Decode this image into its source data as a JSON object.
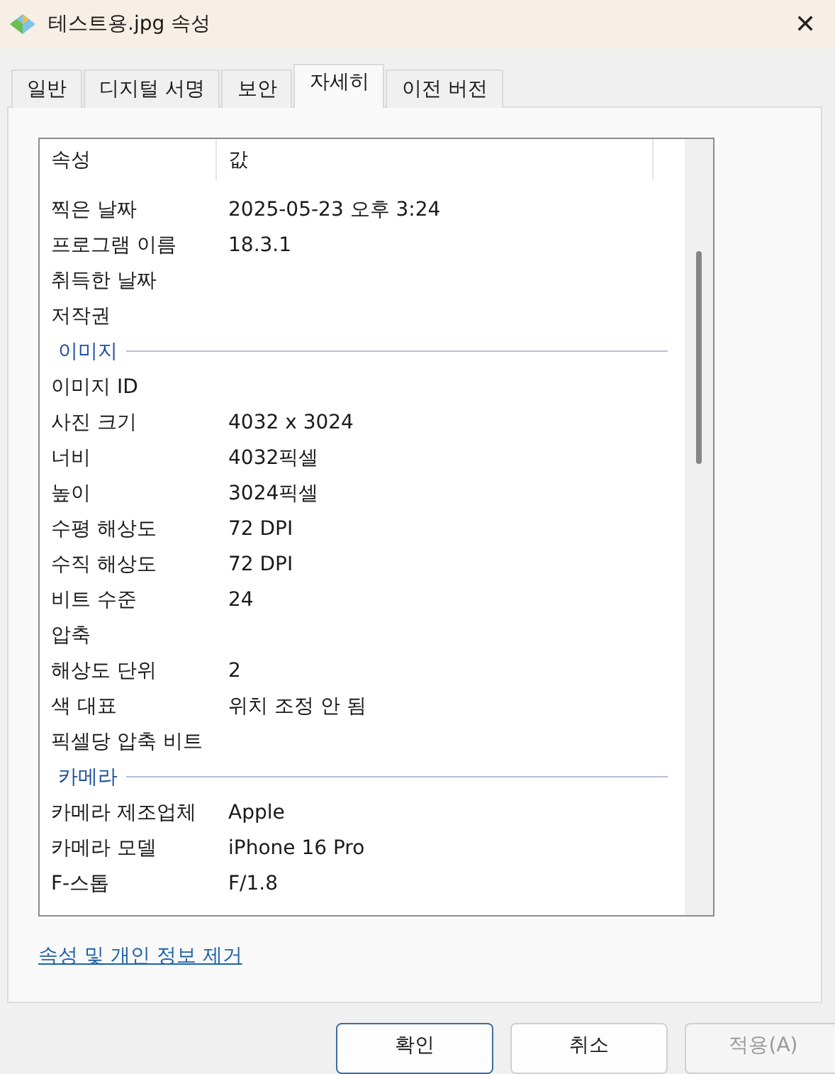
{
  "window": {
    "title": "테스트용.jpg 속성",
    "close": "✕"
  },
  "tabs": [
    {
      "label": "일반",
      "selected": false
    },
    {
      "label": "디지털 서명",
      "selected": false
    },
    {
      "label": "보안",
      "selected": false
    },
    {
      "label": "자세히",
      "selected": true
    },
    {
      "label": "이전 버전",
      "selected": false
    }
  ],
  "table": {
    "columns": [
      "속성",
      "값"
    ],
    "rows": [
      {
        "kind": "row",
        "name": "찍은 날짜",
        "value": "2025-05-23 오후 3:24"
      },
      {
        "kind": "row",
        "name": "프로그램 이름",
        "value": "18.3.1"
      },
      {
        "kind": "row",
        "name": "취득한 날짜"
      },
      {
        "kind": "row",
        "name": "저작권"
      },
      {
        "kind": "group",
        "name": "이미지"
      },
      {
        "kind": "row",
        "name": "이미지 ID"
      },
      {
        "kind": "row",
        "name": "사진 크기",
        "value": "4032 x 3024"
      },
      {
        "kind": "row",
        "name": "너비",
        "value": "4032픽셀"
      },
      {
        "kind": "row",
        "name": "높이",
        "value": "3024픽셀"
      },
      {
        "kind": "row",
        "name": "수평 해상도",
        "value": "72 DPI"
      },
      {
        "kind": "row",
        "name": "수직 해상도",
        "value": "72 DPI"
      },
      {
        "kind": "row",
        "name": "비트 수준",
        "value": "24"
      },
      {
        "kind": "row",
        "name": "압축"
      },
      {
        "kind": "row",
        "name": "해상도 단위",
        "value": "2"
      },
      {
        "kind": "row",
        "name": "색 대표",
        "value": "위치 조정 안 됨"
      },
      {
        "kind": "row",
        "name": "픽셀당 압축 비트"
      },
      {
        "kind": "group",
        "name": "카메라"
      },
      {
        "kind": "row",
        "name": "카메라 제조업체",
        "value": "Apple"
      },
      {
        "kind": "row",
        "name": "카메라 모델",
        "value": "iPhone 16 Pro"
      },
      {
        "kind": "row",
        "name": "F-스톱",
        "value": "F/1.8"
      }
    ]
  },
  "link": "속성 및 개인 정보 제거",
  "buttons": [
    {
      "label": "확인",
      "kind": "default",
      "disabled": false
    },
    {
      "label": "취소",
      "kind": "normal",
      "disabled": false
    },
    {
      "label": "적용(A)",
      "kind": "normal",
      "disabled": true
    }
  ]
}
